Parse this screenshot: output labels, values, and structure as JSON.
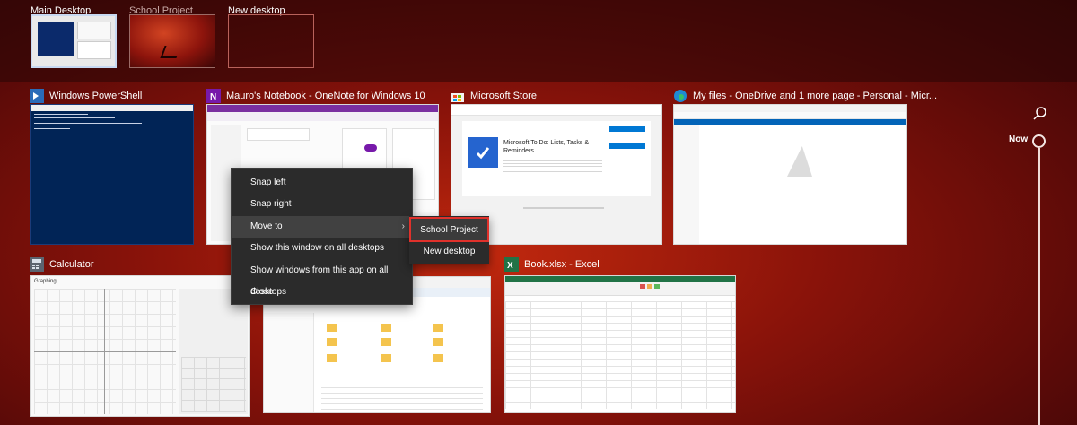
{
  "desktops": [
    {
      "label": "Main Desktop",
      "active": true
    },
    {
      "label": "School Project",
      "active": false
    },
    {
      "label": "New desktop",
      "active": false
    }
  ],
  "windows": {
    "powershell": {
      "title": "Windows PowerShell",
      "icon": "powershell-icon"
    },
    "onenote": {
      "title": "Mauro's Notebook - OneNote for Windows 10",
      "icon": "onenote-icon"
    },
    "store": {
      "title": "Microsoft Store",
      "icon": "store-icon",
      "app_name": "Microsoft To Do: Lists, Tasks & Reminders"
    },
    "edge": {
      "title": "My files - OneDrive and 1 more page - Personal - Micr...",
      "icon": "edge-icon"
    },
    "calculator": {
      "title": "Calculator",
      "icon": "calculator-icon",
      "mode": "Graphing"
    },
    "excel": {
      "title": "Book.xlsx - Excel",
      "icon": "excel-icon"
    }
  },
  "context_menu": {
    "items": [
      "Snap left",
      "Snap right",
      "Move to",
      "Show this window on all desktops",
      "Show windows from this app on all desktops",
      "Close"
    ],
    "chevron": "›"
  },
  "submenu": {
    "items": [
      "School Project",
      "New desktop"
    ]
  },
  "timeline": {
    "now_label": "Now"
  },
  "colors": {
    "accent_selection": "#e0312b",
    "active_desktop_border": "#c7d9f2",
    "menu_bg": "#2b2b2b",
    "powershell_bg": "#012456",
    "excel_green": "#217346",
    "onenote_purple": "#7719aa",
    "store_blue": "#0078d4"
  }
}
